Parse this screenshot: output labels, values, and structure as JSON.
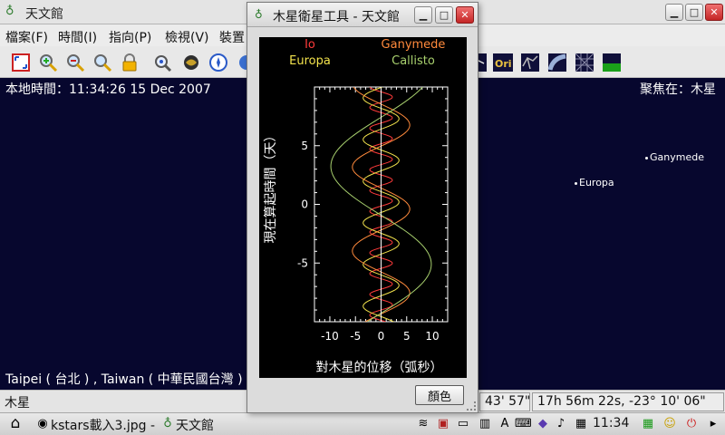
{
  "main_window": {
    "title": "天文館",
    "menus": [
      "檔案(F)",
      "時間(I)",
      "指向(P)",
      "檢視(V)",
      "裝置"
    ],
    "sky": {
      "local_time": "本地時間：11:34:26   15 Dec 2007",
      "focus": "聚焦在：木星",
      "location": "Taipei ( 台北 ) , Taiwan ( 中華民國台灣 )",
      "objects": [
        {
          "name": "Ganymede"
        },
        {
          "name": "Europa"
        }
      ]
    },
    "status": {
      "object": "木星",
      "altaz": "43' 57\"",
      "radec": "17h 56m 22s,  -23° 10' 06\""
    }
  },
  "dialog": {
    "title": "木星衛星工具 - 天文館",
    "color_button_label": "顏色"
  },
  "chart_data": {
    "type": "line",
    "legend": [
      {
        "name": "Io",
        "color": "#ff3b3b"
      },
      {
        "name": "Ganymede",
        "color": "#ff8a3c"
      },
      {
        "name": "Europa",
        "color": "#f2e24c"
      },
      {
        "name": "Callisto",
        "color": "#a8d06e"
      }
    ],
    "xlabel": "對木星的位移（弧秒）",
    "ylabel": "現在算起時間（天）",
    "xlim": [
      -13,
      13
    ],
    "ylim": [
      -10,
      10
    ],
    "xticks": [
      -10,
      -5,
      0,
      5,
      10
    ],
    "yticks": [
      5,
      0,
      -5
    ],
    "series": [
      {
        "name": "Io",
        "amplitude": 2.2,
        "period_days": 1.77,
        "phase_deg": 30
      },
      {
        "name": "Europa",
        "amplitude": 3.5,
        "period_days": 3.55,
        "phase_deg": 70
      },
      {
        "name": "Ganymede",
        "amplitude": 5.6,
        "period_days": 7.15,
        "phase_deg": 110
      },
      {
        "name": "Callisto",
        "amplitude": 9.8,
        "period_days": 16.69,
        "phase_deg": 200
      }
    ]
  },
  "taskbar": {
    "tasks": [
      "kstars載入3.jpg -",
      "天文館"
    ],
    "clock": "11:34"
  },
  "colors": {
    "sky_bg": "#07072e",
    "plot_bg": "#000000",
    "axis": "#ffffff"
  }
}
